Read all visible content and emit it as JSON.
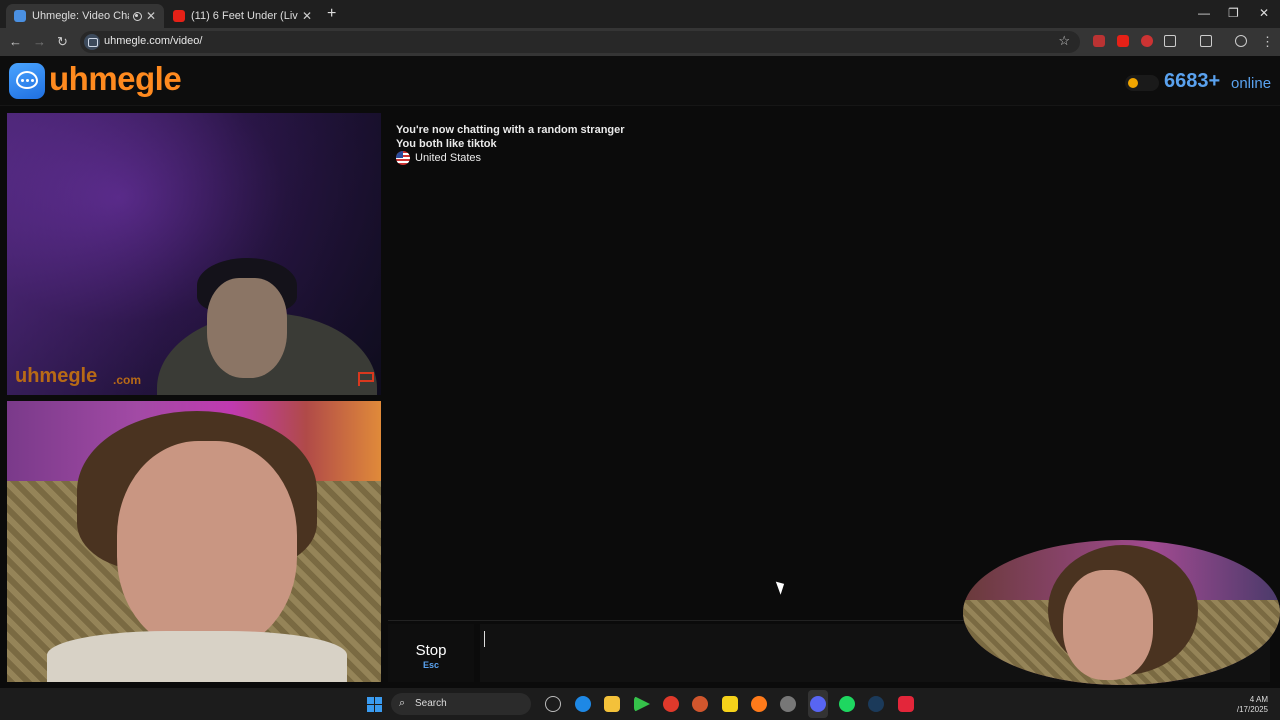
{
  "browser": {
    "tabs": [
      {
        "title": "Uhmegle: Video Chat | Ome",
        "active": true
      },
      {
        "title": "(11) 6 Feet Under (Live From M",
        "active": false
      }
    ],
    "url": "uhmegle.com/video/",
    "window_controls": {
      "minimize": "—",
      "restore": "❐",
      "close": "✕"
    }
  },
  "header": {
    "logo_text": "uhmegle",
    "online_count": "6683+",
    "online_label": "online",
    "colors": {
      "logo": "#ff8a1f",
      "online": "#5aa2ef",
      "toggle_knob": "#f0a500"
    }
  },
  "stranger_video": {
    "watermark": "uhmegle",
    "watermark_domain": ".com"
  },
  "chat": {
    "messages": [
      "You're now chatting with a random stranger",
      "You both like tiktok"
    ],
    "country": "United States"
  },
  "controls": {
    "stop_label": "Stop",
    "stop_shortcut": "Esc",
    "message_value": ""
  },
  "taskbar": {
    "search_label": "Search",
    "clock_time": "4 AM",
    "clock_date": "/17/2025"
  }
}
